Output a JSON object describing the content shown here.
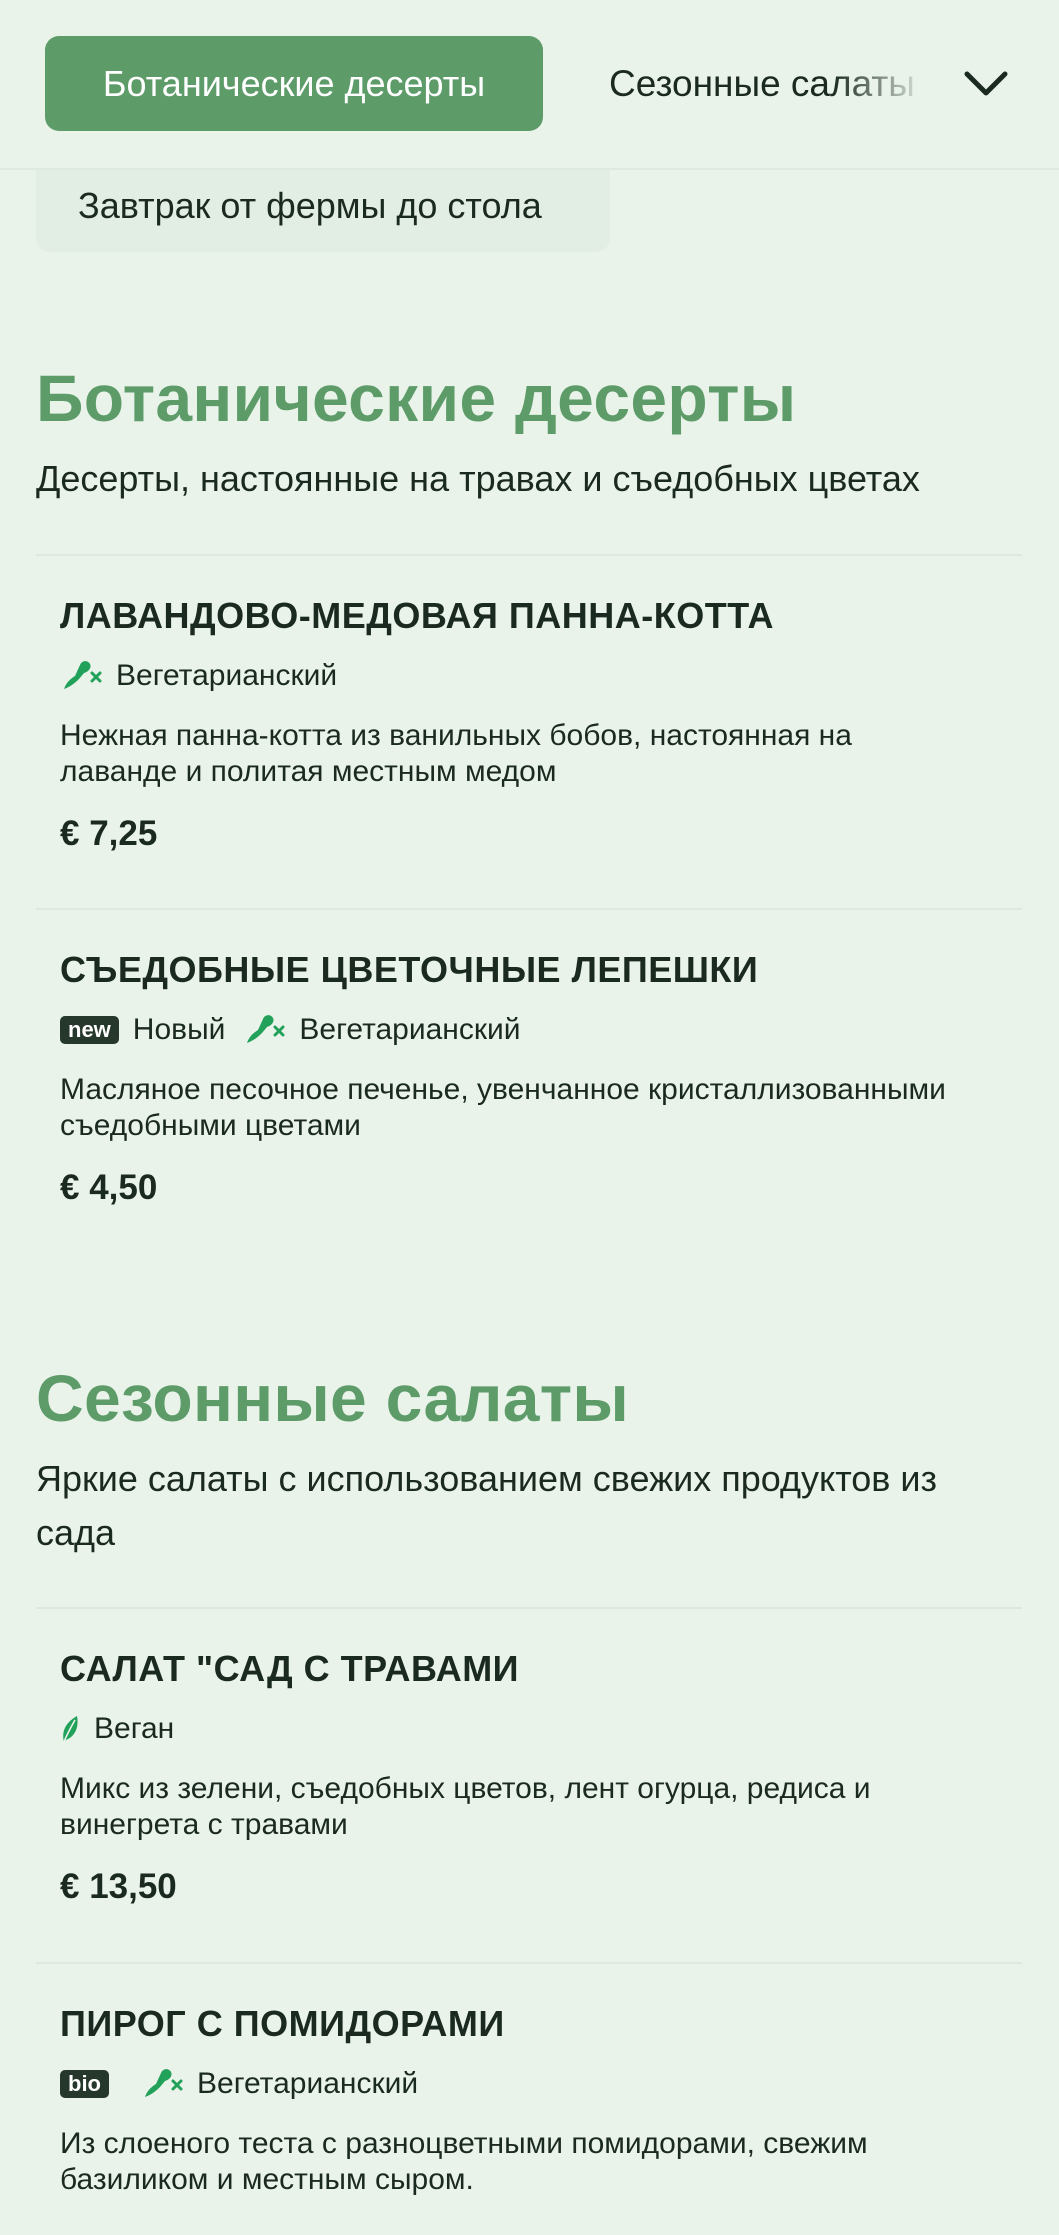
{
  "categories": {
    "active": "Ботанические десерты",
    "next": "Сезонные салаты",
    "row2": "Завтрак от фермы до стола"
  },
  "sections": [
    {
      "title": "Ботанические десерты",
      "description": "Десерты, настоянные на травах и съедобных цветах",
      "items": [
        {
          "name": "ЛАВАНДОВО-МЕДОВАЯ ПАННА-КОТТА",
          "tags": [
            {
              "icon": "vegetarian-icon",
              "label": "Вегетарианский"
            }
          ],
          "description": "Нежная панна-котта из ванильных бобов, настоянная на лаванде и политая местным медом",
          "price": "€ 7,25"
        },
        {
          "name": "СЪЕДОБНЫЕ ЦВЕТОЧНЫЕ ЛЕПЕШКИ",
          "tags": [
            {
              "badge": "new",
              "label": "Новый"
            },
            {
              "icon": "vegetarian-icon",
              "label": "Вегетарианский"
            }
          ],
          "description": "Масляное песочное печенье, увенчанное кристаллизованными съедобными цветами",
          "price": "€ 4,50"
        }
      ]
    },
    {
      "title": "Сезонные салаты",
      "description": "Яркие салаты с использованием свежих продуктов из сада",
      "items": [
        {
          "name": "САЛАТ \"САД С ТРАВАМИ",
          "tags": [
            {
              "icon": "vegan-leaf-icon",
              "label": "Веган"
            }
          ],
          "description": "Микс из зелени, съедобных цветов, лент огурца, редиса и винегрета с травами",
          "price": "€ 13,50"
        },
        {
          "name": "ПИРОГ С ПОМИДОРАМИ",
          "tags": [
            {
              "badge": "bio"
            },
            {
              "icon": "vegetarian-icon",
              "label": "Вегетарианский"
            }
          ],
          "description": "Из слоеного теста с разноцветными помидорами, свежим базиликом и местным сыром."
        }
      ]
    }
  ],
  "colors": {
    "background": "#e9f3ea",
    "accent": "#5d9b69",
    "text": "#1b2a20",
    "icon_green": "#22a15a",
    "badge_bg": "#26372c"
  }
}
